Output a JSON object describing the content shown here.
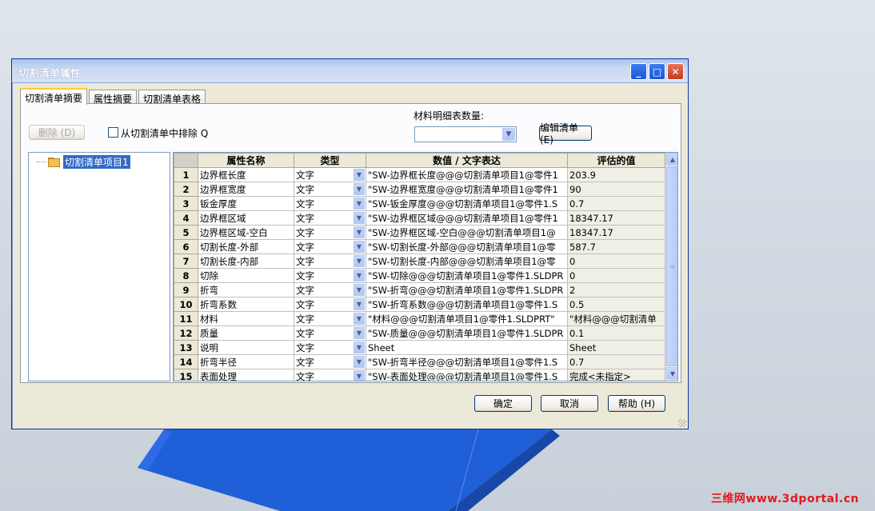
{
  "dialog": {
    "title": "切割清单属性",
    "window_buttons": {
      "minimize": "_",
      "maximize": "□",
      "close": "✕"
    }
  },
  "tabs": [
    {
      "label": "切割清单摘要",
      "active": true
    },
    {
      "label": "属性摘要",
      "active": false
    },
    {
      "label": "切割清单表格",
      "active": false
    }
  ],
  "summary": {
    "delete_label": "删除 (D)",
    "exclude_label": "从切割清单中排除 Q",
    "exclude_checked": false,
    "bom_qty_label": "材料明细表数量:",
    "bom_qty_value": "",
    "edit_list_label": "编辑清单 (E)"
  },
  "tree": {
    "item": "切割清单项目1"
  },
  "grid": {
    "columns": [
      "属性名称",
      "类型",
      "数值 / 文字表达",
      "评估的值"
    ],
    "rows": [
      {
        "n": "1",
        "name": "边界框长度",
        "type": "文字",
        "expr": "\"SW-边界框长度@@@切割清单项目1@零件1",
        "value": "203.9"
      },
      {
        "n": "2",
        "name": "边界框宽度",
        "type": "文字",
        "expr": "\"SW-边界框宽度@@@切割清单项目1@零件1",
        "value": "90"
      },
      {
        "n": "3",
        "name": "钣金厚度",
        "type": "文字",
        "expr": "\"SW-钣金厚度@@@切割清单项目1@零件1.S",
        "value": "0.7"
      },
      {
        "n": "4",
        "name": "边界框区域",
        "type": "文字",
        "expr": "\"SW-边界框区域@@@切割清单项目1@零件1",
        "value": "18347.17"
      },
      {
        "n": "5",
        "name": "边界框区域-空白",
        "type": "文字",
        "expr": "\"SW-边界框区域-空白@@@切割清单项目1@",
        "value": "18347.17"
      },
      {
        "n": "6",
        "name": "切割长度-外部",
        "type": "文字",
        "expr": "\"SW-切割长度-外部@@@切割清单项目1@零",
        "value": "587.7"
      },
      {
        "n": "7",
        "name": "切割长度-内部",
        "type": "文字",
        "expr": "\"SW-切割长度-内部@@@切割清单项目1@零",
        "value": "0"
      },
      {
        "n": "8",
        "name": "切除",
        "type": "文字",
        "expr": "\"SW-切除@@@切割清单项目1@零件1.SLDPR",
        "value": "0"
      },
      {
        "n": "9",
        "name": "折弯",
        "type": "文字",
        "expr": "\"SW-折弯@@@切割清单项目1@零件1.SLDPR",
        "value": "2"
      },
      {
        "n": "10",
        "name": "折弯系数",
        "type": "文字",
        "expr": "\"SW-折弯系数@@@切割清单项目1@零件1.S",
        "value": "0.5"
      },
      {
        "n": "11",
        "name": "材料",
        "type": "文字",
        "expr": "\"材料@@@切割清单项目1@零件1.SLDPRT\"",
        "value": "\"材料@@@切割清单"
      },
      {
        "n": "12",
        "name": "质量",
        "type": "文字",
        "expr": "\"SW-质量@@@切割清单项目1@零件1.SLDPR",
        "value": "0.1"
      },
      {
        "n": "13",
        "name": "说明",
        "type": "文字",
        "expr": "Sheet",
        "value": "Sheet"
      },
      {
        "n": "14",
        "name": "折弯半径",
        "type": "文字",
        "expr": "\"SW-折弯半径@@@切割清单项目1@零件1.S",
        "value": "0.7"
      },
      {
        "n": "15",
        "name": "表面处理",
        "type": "文字",
        "expr": "\"SW-表面处理@@@切割清单项目1@零件1.S",
        "value": "完成<未指定>"
      }
    ]
  },
  "footer": {
    "ok_label": "确定",
    "cancel_label": "取消",
    "help_label": "帮助 (H)"
  },
  "watermark": "三维网www.3dportal.cn",
  "colors": {
    "titlebar_text": "#ffffff",
    "selection": "#316ac5",
    "part_blue": "#1f5fd8",
    "watermark": "#e0191e"
  }
}
